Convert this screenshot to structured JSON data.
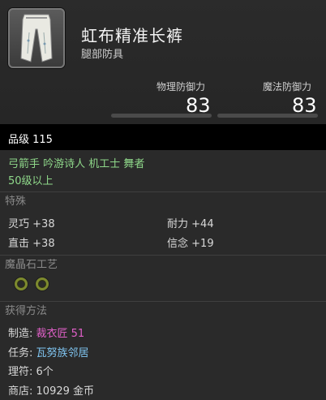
{
  "item": {
    "name": "虹布精准长裤",
    "category": "腿部防具",
    "icon": "white-trousers-icon"
  },
  "stats": [
    {
      "label": "物理防御力",
      "value": "83"
    },
    {
      "label": "魔法防御力",
      "value": "83"
    }
  ],
  "item_level": "品级 115",
  "classes": "弓箭手 吟游诗人 机工士 舞者",
  "level_requirement": "50级以上",
  "bonuses": {
    "title": "特殊",
    "entries": [
      {
        "name": "灵巧",
        "value": "+38"
      },
      {
        "name": "耐力",
        "value": "+44"
      },
      {
        "name": "直击",
        "value": "+38"
      },
      {
        "name": "信念",
        "value": "+19"
      }
    ]
  },
  "materia": {
    "title": "魔晶石工艺",
    "slots": 2,
    "slot_color": "#7d8a2e"
  },
  "acquisition": {
    "title": "获得方法",
    "entries": [
      {
        "label": "制造:",
        "value": "裁衣匠 51",
        "color": "#e060c8"
      },
      {
        "label": "任务:",
        "value": "瓦努族邻居",
        "color": "#7fc4f0"
      },
      {
        "label": "理符:",
        "value": "6个",
        "color": "#d8d8d8"
      },
      {
        "label": "商店:",
        "value": "10929 金币",
        "color": "#d8d8d8"
      }
    ]
  }
}
